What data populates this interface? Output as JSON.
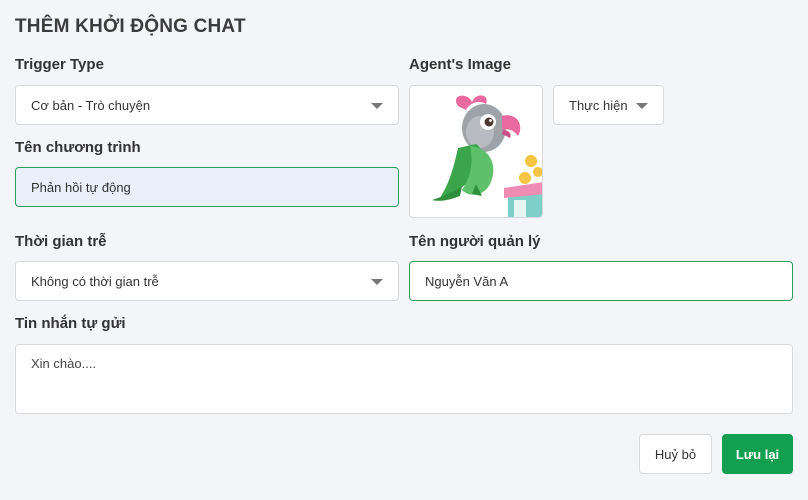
{
  "page": {
    "title": "THÊM KHỞI ĐỘNG CHAT"
  },
  "trigger": {
    "label": "Trigger Type",
    "value": "Cơ bản - Trò chuyện"
  },
  "agent": {
    "label": "Agent's Image",
    "action_label": "Thực hiện"
  },
  "program": {
    "label": "Tên chương trình",
    "value": "Phản hồi tự động"
  },
  "delay": {
    "label": "Thời gian trễ",
    "value": "Không có thời gian trễ"
  },
  "manager": {
    "label": "Tên người quản lý",
    "value": "Nguyễn Văn A"
  },
  "message": {
    "label": "Tin nhắn tự gửi",
    "value": "Xin chào...."
  },
  "actions": {
    "cancel": "Huỷ bỏ",
    "save": "Lưu lại"
  },
  "colors": {
    "accent": "#129f4f",
    "focus_border": "#2f9e57",
    "filled_bg": "#eaf0fb"
  }
}
